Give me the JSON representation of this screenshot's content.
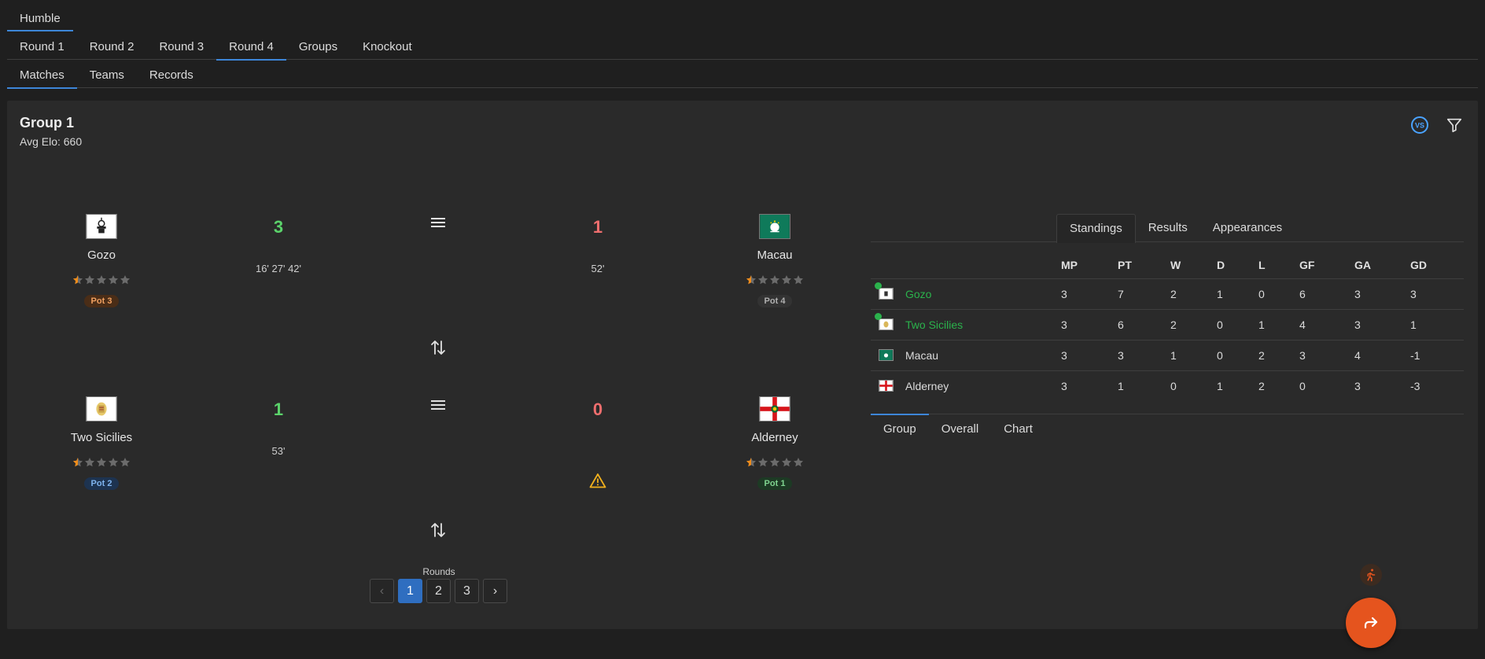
{
  "top_tabs": [
    "Humble"
  ],
  "round_tabs": [
    "Round 1",
    "Round 2",
    "Round 3",
    "Round 4",
    "Groups",
    "Knockout"
  ],
  "sub_tabs": [
    "Matches",
    "Teams",
    "Records"
  ],
  "group": {
    "title": "Group 1",
    "avg_elo": "Avg Elo: 660"
  },
  "header_icons": [
    "vs-icon",
    "filter-icon"
  ],
  "matches": [
    {
      "home": {
        "name": "Gozo",
        "rating": 0.5,
        "pot": "Pot 3",
        "pot_color": "#f0a060",
        "pot_bg": "#4a2d17"
      },
      "home_score": "3",
      "home_minutes": "16' 27' 42'",
      "away": {
        "name": "Macau",
        "rating": 0.5,
        "pot": "Pot 4",
        "pot_color": "#b0b0b0",
        "pot_bg": "#333333"
      },
      "away_score": "1",
      "away_minutes": "52'"
    },
    {
      "home": {
        "name": "Two Sicilies",
        "rating": 0.5,
        "pot": "Pot 2",
        "pot_color": "#7fb4ef",
        "pot_bg": "#1d3350"
      },
      "home_score": "1",
      "home_minutes": "53'",
      "away": {
        "name": "Alderney",
        "rating": 0.5,
        "pot": "Pot 1",
        "pot_color": "#7fd48f",
        "pot_bg": "#1d3a24"
      },
      "away_score": "0",
      "away_minutes": ""
    }
  ],
  "colors": {
    "win": "#5bd36b",
    "loss": "#ee6e6e",
    "warning": "#f2b11d",
    "accent": "#3d86d8",
    "fab": "#e5541e",
    "qualified": "#2bb24c"
  },
  "rounds": {
    "label": "Rounds",
    "pages": [
      "1",
      "2",
      "3"
    ],
    "active": "1",
    "prev": "‹",
    "next": "›"
  },
  "standings_tabs": [
    "Standings",
    "Results",
    "Appearances"
  ],
  "standings": {
    "columns": [
      "MP",
      "PT",
      "W",
      "D",
      "L",
      "GF",
      "GA",
      "GD"
    ],
    "rows": [
      {
        "team": "Gozo",
        "qualified": true,
        "cells": [
          "3",
          "7",
          "2",
          "1",
          "0",
          "6",
          "3",
          "3"
        ]
      },
      {
        "team": "Two Sicilies",
        "qualified": true,
        "cells": [
          "3",
          "6",
          "2",
          "0",
          "1",
          "4",
          "3",
          "1"
        ]
      },
      {
        "team": "Macau",
        "qualified": false,
        "cells": [
          "3",
          "3",
          "1",
          "0",
          "2",
          "3",
          "4",
          "-1"
        ]
      },
      {
        "team": "Alderney",
        "qualified": false,
        "cells": [
          "3",
          "1",
          "0",
          "1",
          "2",
          "0",
          "3",
          "-3"
        ]
      }
    ]
  },
  "bottom_tabs": [
    "Group",
    "Overall",
    "Chart"
  ]
}
